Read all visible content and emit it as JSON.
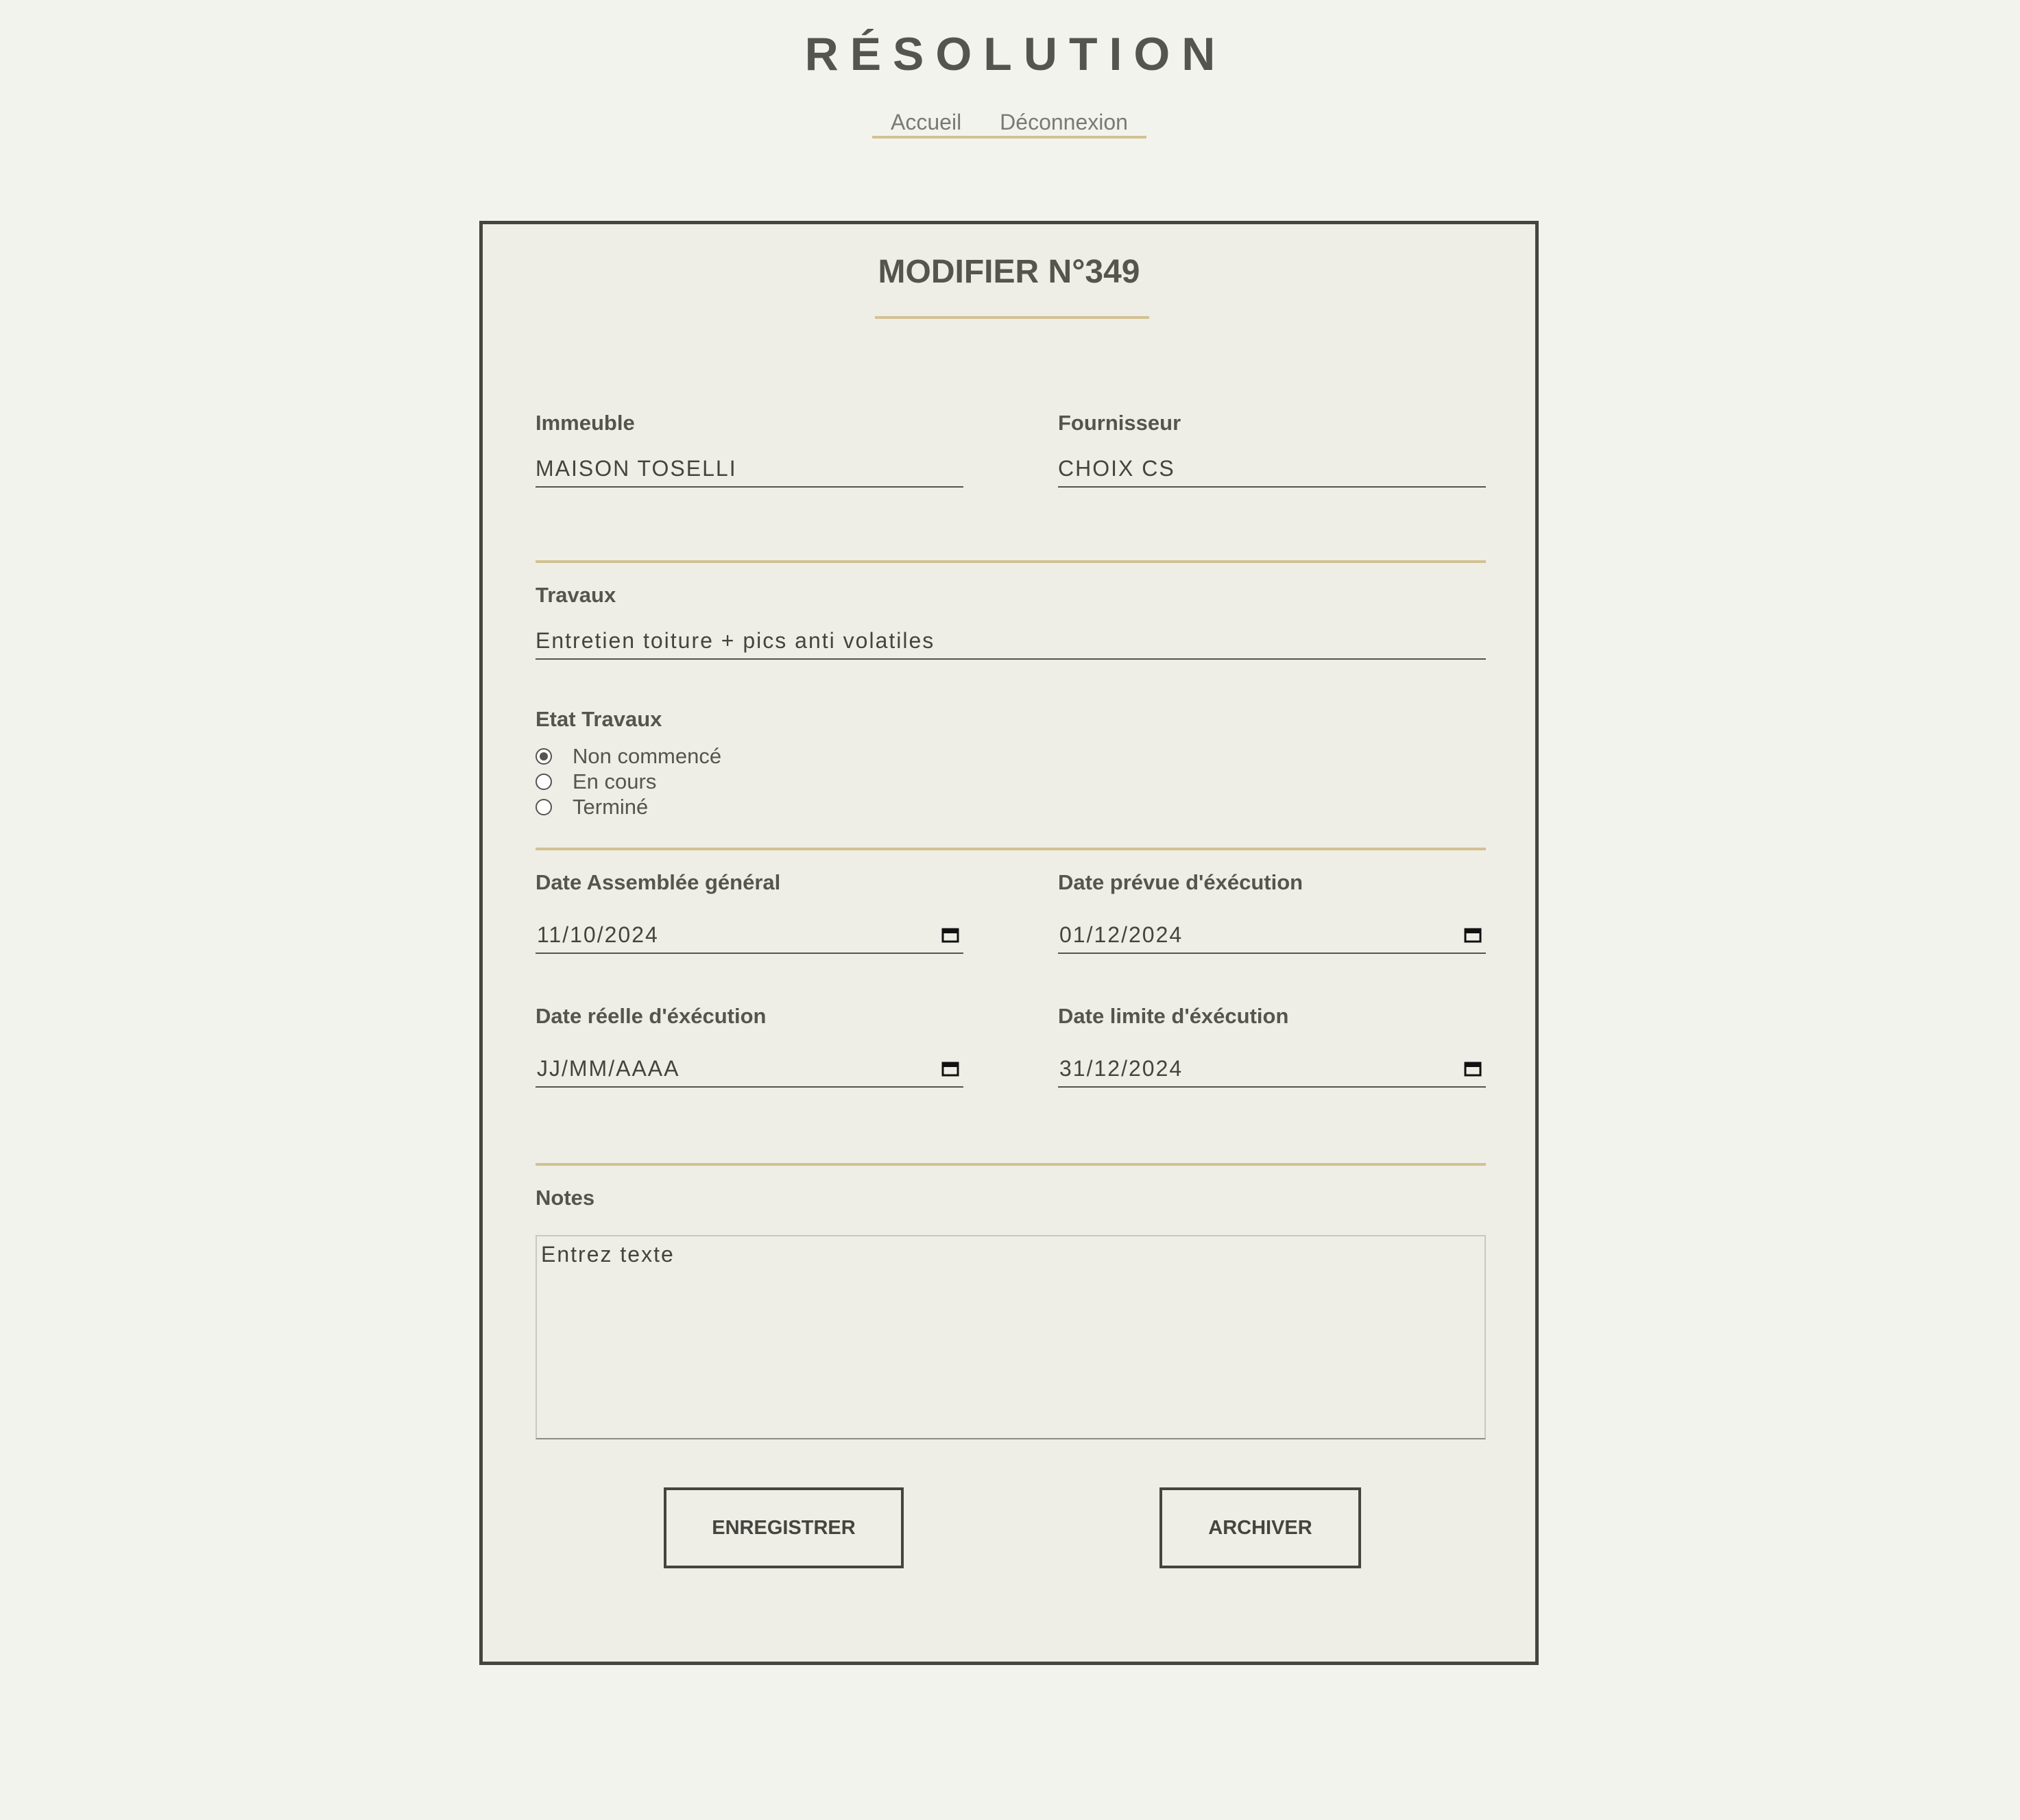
{
  "site": {
    "title": "RÉSOLUTION"
  },
  "nav": {
    "home": "Accueil",
    "logout": "Déconnexion"
  },
  "form": {
    "title": "MODIFIER N°349",
    "building": {
      "label": "Immeuble",
      "value": "MAISON TOSELLI"
    },
    "supplier": {
      "label": "Fournisseur",
      "value": "CHOIX CS"
    },
    "works": {
      "label": "Travaux",
      "value": "Entretien toiture + pics anti volatiles"
    },
    "status": {
      "label": "Etat Travaux",
      "options": [
        "Non commencé",
        "En cours",
        "Terminé"
      ],
      "selected": "Non commencé"
    },
    "date_assembly": {
      "label": "Date Assemblée général",
      "value": "11/10/2024"
    },
    "date_planned": {
      "label": "Date prévue d'éxécution",
      "value": "01/12/2024"
    },
    "date_actual": {
      "label": "Date réelle d'éxécution",
      "value": "JJ/MM/AAAA"
    },
    "date_limit": {
      "label": "Date limite d'éxécution",
      "value": "31/12/2024"
    },
    "notes": {
      "label": "Notes",
      "placeholder": "Entrez texte"
    },
    "save_label": "ENREGISTRER",
    "archive_label": "ARCHIVER"
  },
  "icons": {
    "calendar": "calendar-icon"
  },
  "colors": {
    "background": "#f3f3ee",
    "card": "#eeeee7",
    "text": "#55554f",
    "accent": "#d2c291",
    "border": "#45453f"
  }
}
